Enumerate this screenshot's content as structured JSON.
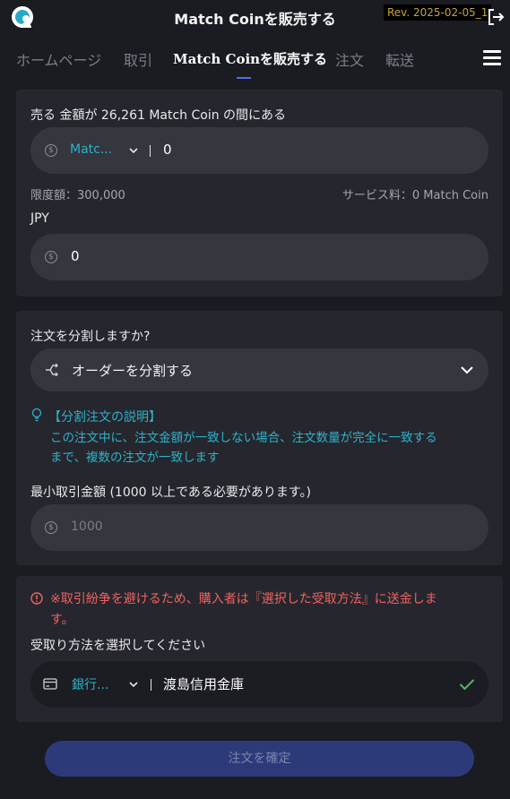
{
  "header": {
    "title": "Match Coinを販売する",
    "rev": "Rev. 2025-02-05_1"
  },
  "nav": {
    "tabs": [
      {
        "label": "ホームページ"
      },
      {
        "label": "取引"
      },
      {
        "label": "Match Coinを販売する"
      },
      {
        "label": "注文"
      },
      {
        "label": "転送"
      }
    ]
  },
  "sell": {
    "prompt": "売る 金額が 26,261 Match Coin の間にある",
    "currency_selected": "Matc...",
    "amount_value": "0",
    "limit_text": "限度額：300,000",
    "fee_text": "サービス料：0 Match Coin",
    "jpy_label": "JPY",
    "jpy_value": "0"
  },
  "split": {
    "question": "注文を分割しますか?",
    "selected_option": "オーダーを分割する",
    "info_title": "【分割注文の説明】",
    "info_line1": "この注文中に、注文金額が一致しない場合、注文数量が完全に一致する",
    "info_line2": "まで、複数の注文が一致します",
    "min_label": "最小取引金額 (1000 以上である必要があります。)",
    "min_placeholder": "1000"
  },
  "payment": {
    "warning_line1": "※取引紛争を避けるため、購入者は『選択した受取方法』に送金しま",
    "warning_line2": "す。",
    "method_label": "受取り方法を選択してください",
    "method_type": "銀行...",
    "method_value": "渡島信用金庫"
  },
  "actions": {
    "confirm_label": "注文を確定"
  },
  "icons": {
    "currency": "coin-icon",
    "split": "split-arrows-icon",
    "info": "lightbulb-icon",
    "warning": "alert-circle-icon",
    "bank": "bank-card-icon",
    "check": "check-icon",
    "logout": "logout-icon",
    "menu": "hamburger-menu-icon"
  },
  "colors": {
    "accent_cyan": "#2fb1c9",
    "warning_red": "#f0625f",
    "check_green": "#58b36a",
    "nav_indicator": "#4c6ff0",
    "button_bg": "#2d3a7a"
  }
}
